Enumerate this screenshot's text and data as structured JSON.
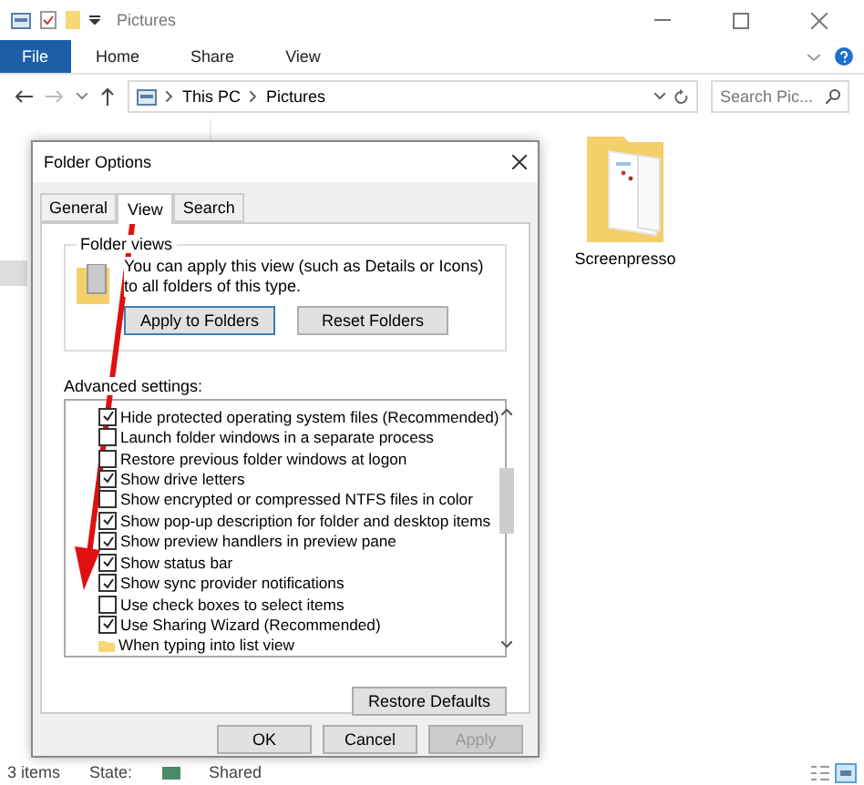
{
  "window": {
    "title": "Pictures"
  },
  "ribbon_tabs": [
    {
      "label": "File",
      "kind": "file"
    },
    {
      "label": "Home",
      "kind": "tab"
    },
    {
      "label": "Share",
      "kind": "tab"
    },
    {
      "label": "View",
      "kind": "tab"
    }
  ],
  "address": {
    "path": [
      "This PC",
      "Pictures"
    ]
  },
  "search": {
    "placeholder": "Search Pic..."
  },
  "files": [
    {
      "name": "Screenpresso"
    }
  ],
  "status_bar": {
    "count": "3 items",
    "state_label": "State:",
    "state": "Shared"
  },
  "dialog": {
    "title": "Folder Options",
    "tabs": [
      {
        "label": "General",
        "selected": false
      },
      {
        "label": "View",
        "selected": true
      },
      {
        "label": "Search",
        "selected": false
      }
    ],
    "group_title": "Folder views",
    "group_text": "You can apply this view (such as Details or Icons) to all folders of this type.",
    "group_buttons": [
      {
        "label": "Apply to Folders",
        "focused": true
      },
      {
        "label": "Reset Folders",
        "focused": false
      }
    ],
    "advanced_label": "Advanced settings:",
    "settings": [
      {
        "kind": "checkbox",
        "label": "Hide protected operating system files (Recommended)",
        "checked": true
      },
      {
        "kind": "checkbox",
        "label": "Launch folder windows in a separate process",
        "checked": false
      },
      {
        "kind": "checkbox",
        "label": "Restore previous folder windows at logon",
        "checked": false
      },
      {
        "kind": "checkbox",
        "label": "Show drive letters",
        "checked": true
      },
      {
        "kind": "checkbox",
        "label": "Show encrypted or compressed NTFS files in color",
        "checked": false
      },
      {
        "kind": "checkbox",
        "label": "Show pop-up description for folder and desktop items",
        "checked": true
      },
      {
        "kind": "checkbox",
        "label": "Show preview handlers in preview pane",
        "checked": true
      },
      {
        "kind": "checkbox",
        "label": "Show status bar",
        "checked": true
      },
      {
        "kind": "checkbox",
        "label": "Show sync provider notifications",
        "checked": true
      },
      {
        "kind": "checkbox",
        "label": "Use check boxes to select items",
        "checked": false
      },
      {
        "kind": "checkbox",
        "label": "Use Sharing Wizard (Recommended)",
        "checked": true
      },
      {
        "kind": "folder",
        "label": "When typing into list view"
      }
    ],
    "restore_button": "Restore Defaults",
    "buttons": [
      {
        "label": "OK",
        "disabled": false
      },
      {
        "label": "Cancel",
        "disabled": false
      },
      {
        "label": "Apply",
        "disabled": true
      }
    ]
  }
}
